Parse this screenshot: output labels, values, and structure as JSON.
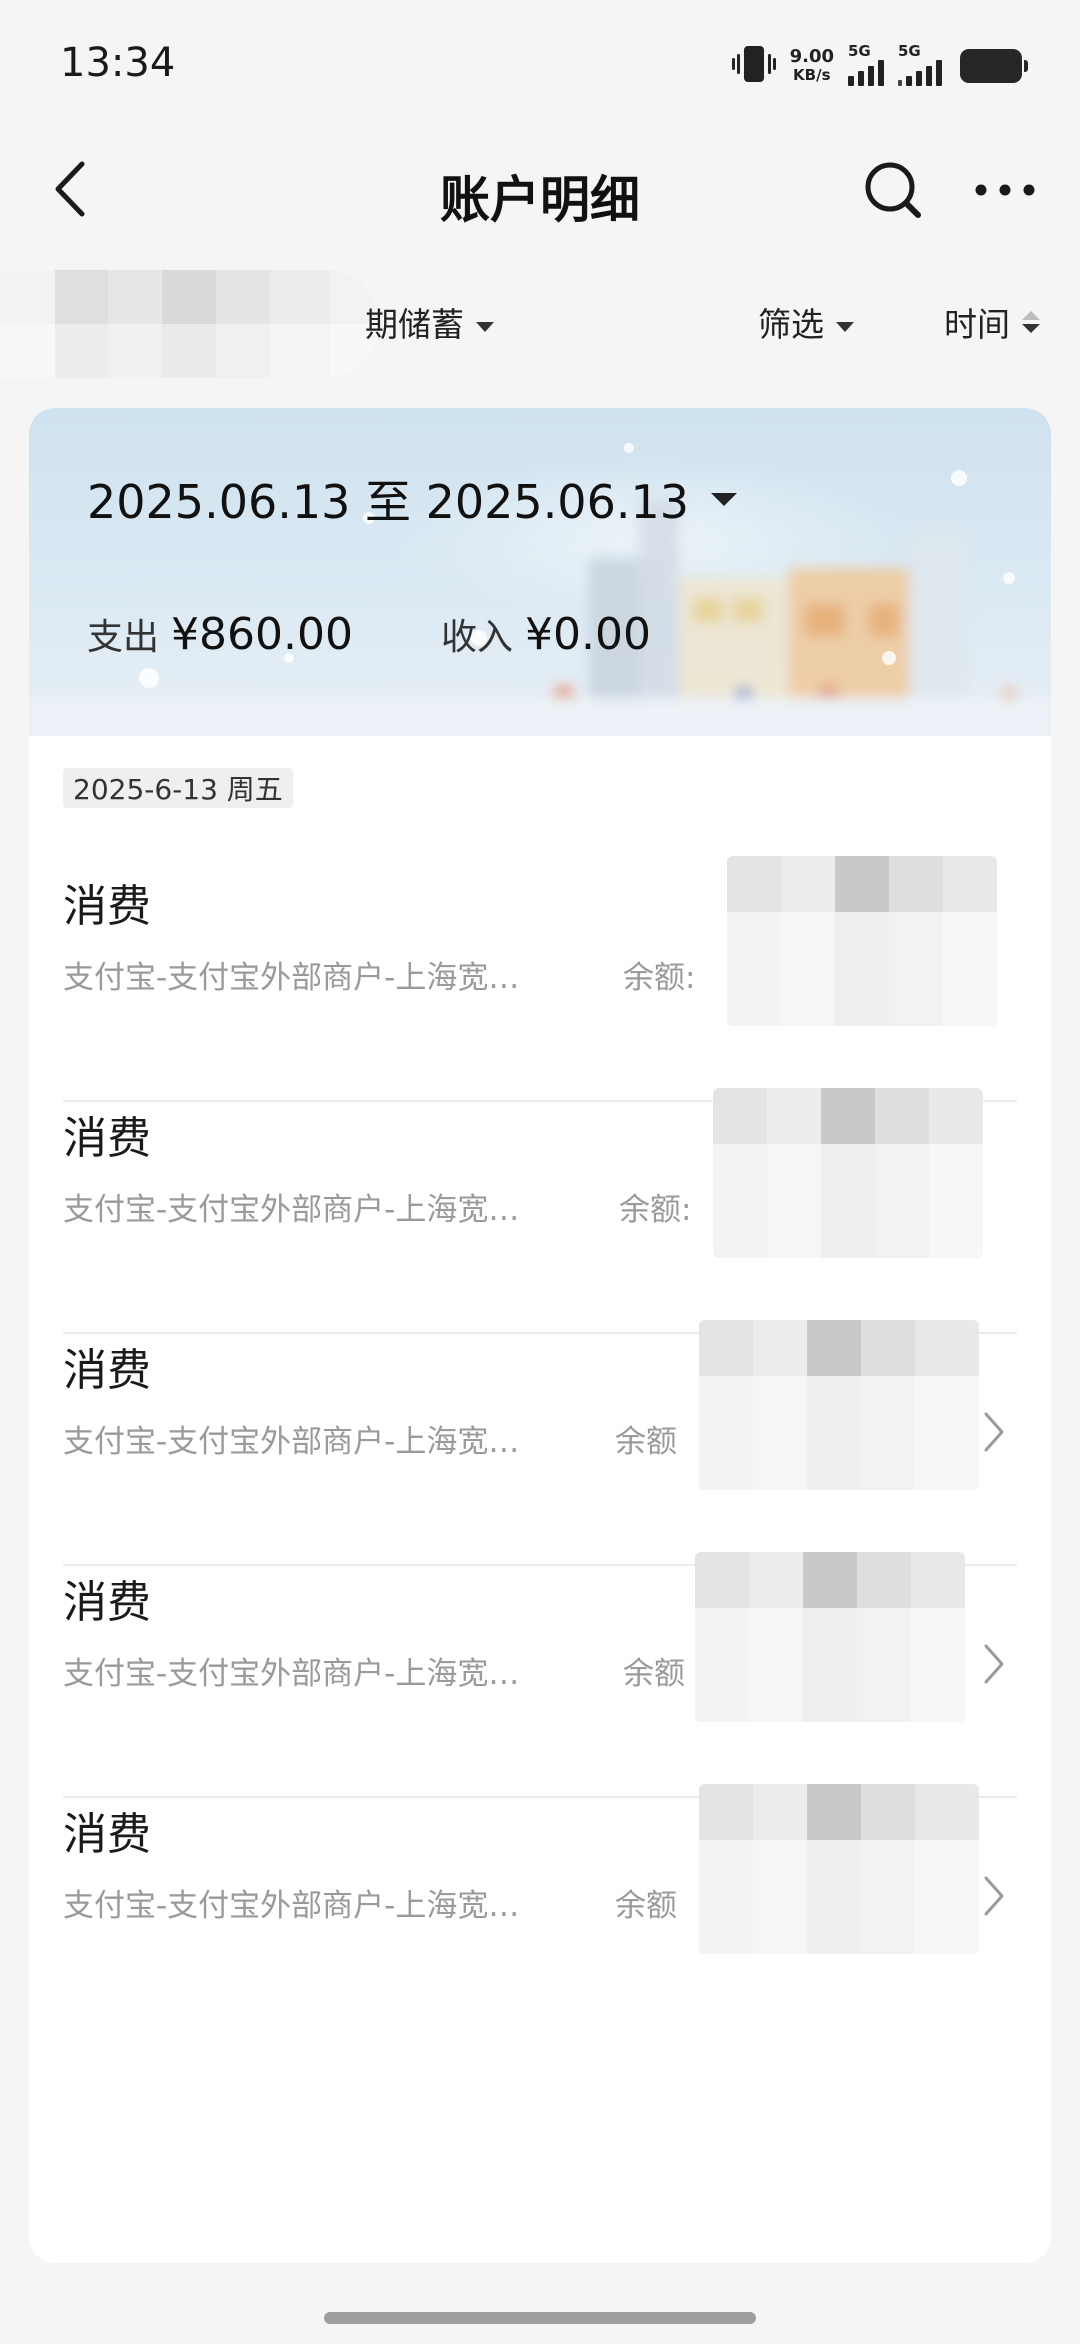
{
  "status_bar": {
    "time": "13:34",
    "net_speed_value": "9.00",
    "net_speed_unit": "KB/s",
    "sim1_label": "5G",
    "sim2_label": "5G"
  },
  "header": {
    "title": "账户明细"
  },
  "filters": {
    "account_label": "期储蓄",
    "filter_label": "筛选",
    "time_label": "时间"
  },
  "summary": {
    "date_range": "2025.06.13 至 2025.06.13",
    "expense_label": "支出",
    "expense_value": "¥860.00",
    "income_label": "收入",
    "income_value": "¥0.00"
  },
  "date_group": "2025-6-13 周五",
  "transactions": [
    {
      "type": "消费",
      "description": "支付宝-支付宝外部商户-上海宽…",
      "balance_label": "余额:"
    },
    {
      "type": "消费",
      "description": "支付宝-支付宝外部商户-上海宽…",
      "balance_label": "余额:"
    },
    {
      "type": "消费",
      "description": "支付宝-支付宝外部商户-上海宽…",
      "balance_label": "余额"
    },
    {
      "type": "消费",
      "description": "支付宝-支付宝外部商户-上海宽…",
      "balance_label": "余额"
    },
    {
      "type": "消费",
      "description": "支付宝-支付宝外部商户-上海宽…",
      "balance_label": "余额"
    }
  ],
  "icons": {
    "back": "chevron-left-icon",
    "search": "search-icon",
    "more": "more-horizontal-icon",
    "row_arrow": "chevron-right-icon"
  }
}
